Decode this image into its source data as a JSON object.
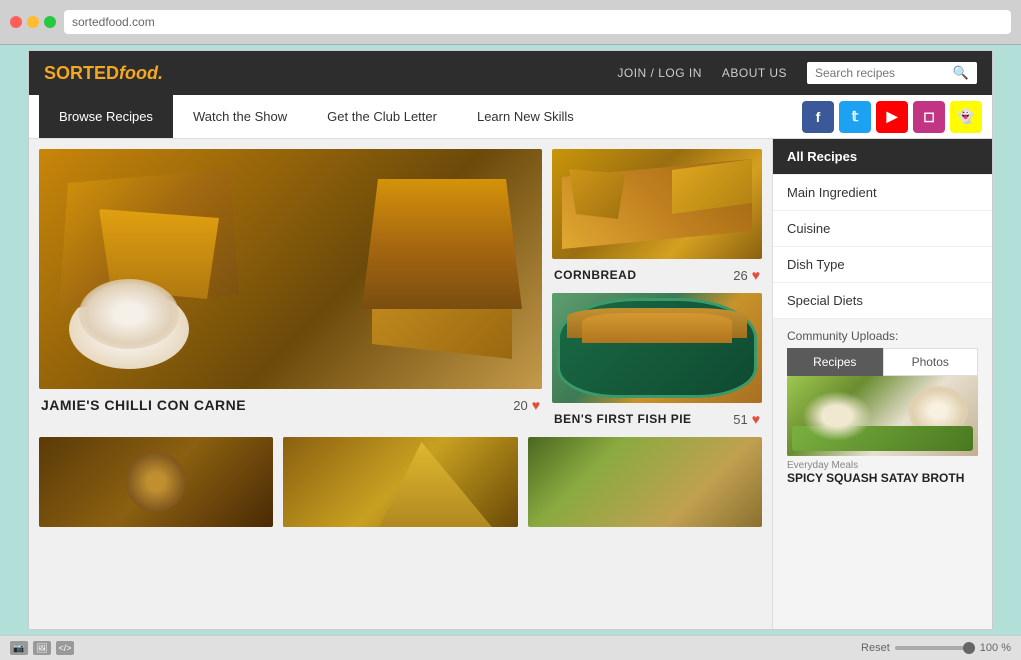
{
  "browser": {
    "address": "sortedfood.com"
  },
  "header": {
    "logo_text": "SORTED",
    "logo_suffix": "food.",
    "nav_join": "JOIN / LOG IN",
    "nav_about": "ABOUT US",
    "search_placeholder": "Search recipes"
  },
  "nav_tabs": [
    {
      "label": "Browse Recipes",
      "active": true
    },
    {
      "label": "Watch the Show",
      "active": false
    },
    {
      "label": "Get the Club Letter",
      "active": false
    },
    {
      "label": "Learn New Skills",
      "active": false
    }
  ],
  "social_icons": [
    {
      "name": "facebook",
      "symbol": "f"
    },
    {
      "name": "twitter",
      "symbol": "t"
    },
    {
      "name": "youtube",
      "symbol": "▶"
    },
    {
      "name": "instagram",
      "symbol": "◻"
    },
    {
      "name": "snapchat",
      "symbol": "👻"
    }
  ],
  "recipes": {
    "featured": {
      "title": "JAMIE'S CHILLI CON CARNE",
      "likes": "20"
    },
    "secondary": [
      {
        "title": "CORNBREAD",
        "likes": "26"
      },
      {
        "title": "BEN'S FIRST FISH PIE",
        "likes": "51"
      }
    ]
  },
  "sidebar": {
    "menu_items": [
      {
        "label": "All Recipes",
        "active": true
      },
      {
        "label": "Main Ingredient",
        "active": false
      },
      {
        "label": "Cuisine",
        "active": false
      },
      {
        "label": "Dish Type",
        "active": false
      },
      {
        "label": "Special Diets",
        "active": false
      }
    ],
    "community_label": "Community Uploads:",
    "community_tabs": [
      {
        "label": "Recipes",
        "active": true
      },
      {
        "label": "Photos",
        "active": false
      }
    ],
    "community_recipe": {
      "category": "Everyday Meals",
      "title": "SPICY SQUASH SATAY BROTH"
    }
  },
  "browser_bottom": {
    "zoom": "100 %",
    "reset": "Reset"
  }
}
